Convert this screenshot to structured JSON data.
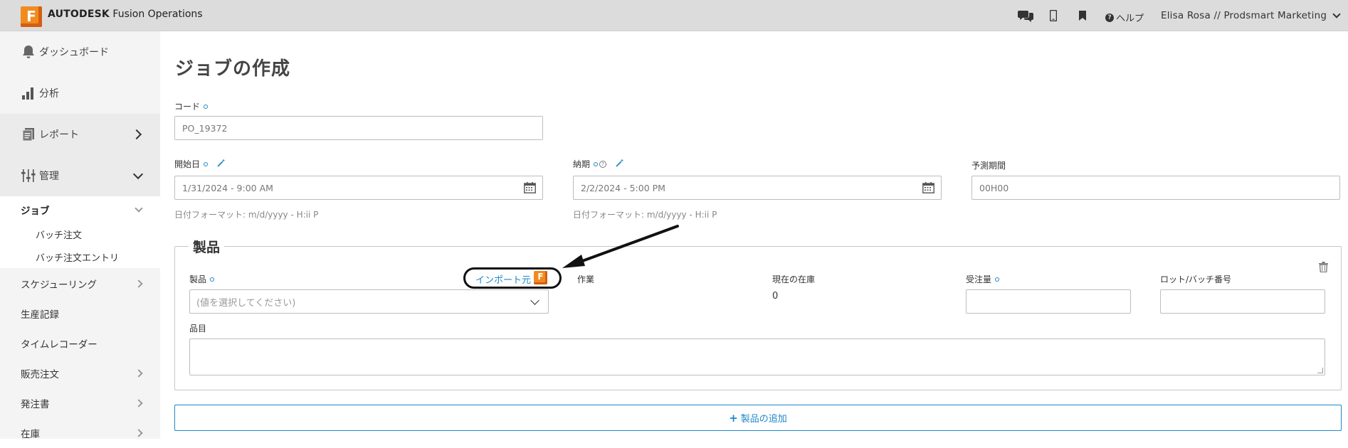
{
  "app": {
    "logo_letter": "F",
    "brand_bold": "AUTODESK",
    "brand_rest": " Fusion Operations",
    "help_label": "ヘルプ",
    "user_label": "Elisa Rosa // Prodsmart Marketing",
    "accent_color": "#1e88c7",
    "brand_color": "#f28b1e"
  },
  "sidebar": {
    "dashboard": "ダッシュボード",
    "analysis": "分析",
    "reports": "レポート",
    "management": "管理",
    "jobs": "ジョブ",
    "batch_orders": "バッチ注文",
    "batch_order_entries": "バッチ注文エントリ",
    "scheduling": "スケジューリング",
    "production_records": "生産記録",
    "time_recorder": "タイムレコーダー",
    "sales_orders": "販売注文",
    "purchase_orders": "発注書",
    "inventory": "在庫"
  },
  "form": {
    "title": "ジョブの作成",
    "code_label": "コード",
    "code_value": "PO_19372",
    "start_label": "開始日",
    "start_value": "1/31/2024 - 9:00 AM",
    "due_label": "納期",
    "due_value": "2/2/2024 - 5:00 PM",
    "forecast_label": "予測期間",
    "forecast_placeholder": "00H00",
    "date_hint": "日付フォーマット: m/d/yyyy - H:ii P"
  },
  "product": {
    "section_title": "製品",
    "product_label": "製品",
    "import_label": "インポート元",
    "select_placeholder": "(値を選択してください)",
    "operation_label": "作業",
    "stock_label": "現在の在庫",
    "stock_value": "0",
    "order_qty_label": "受注量",
    "lot_label": "ロット/バッチ番号",
    "item_label": "品目",
    "add_button": "製品の追加",
    "add_plus": "+"
  }
}
